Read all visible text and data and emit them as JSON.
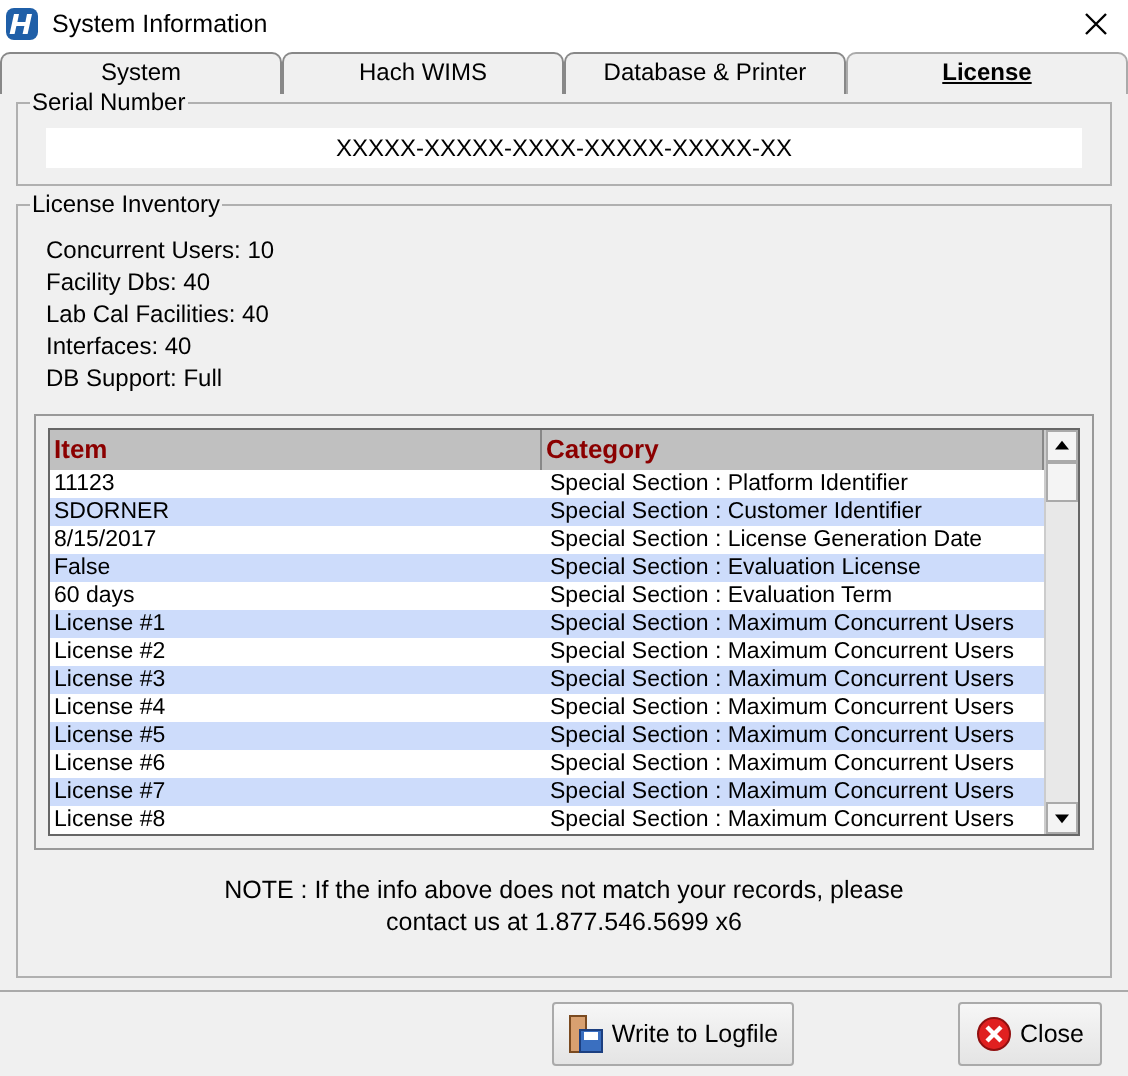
{
  "window": {
    "title": "System Information"
  },
  "tabs": [
    {
      "label": "System",
      "selected": false
    },
    {
      "label": "Hach WIMS",
      "selected": false
    },
    {
      "label": "Database & Printer",
      "selected": false
    },
    {
      "label": "License",
      "selected": true
    }
  ],
  "serial_number": {
    "label": "Serial Number",
    "value": "XXXXX-XXXXX-XXXX-XXXXX-XXXXX-XX"
  },
  "license_inventory": {
    "label": "License Inventory",
    "lines": [
      "Concurrent Users: 10",
      "Facility Dbs: 40",
      "Lab Cal Facilities: 40",
      "Interfaces: 40",
      "DB Support: Full"
    ],
    "table": {
      "columns": [
        "Item",
        "Category"
      ],
      "rows": [
        [
          "11123",
          "Special Section : Platform Identifier"
        ],
        [
          "SDORNER",
          "Special Section : Customer Identifier"
        ],
        [
          "8/15/2017",
          "Special Section : License Generation Date"
        ],
        [
          "False",
          "Special Section : Evaluation License"
        ],
        [
          "60 days",
          "Special Section : Evaluation Term"
        ],
        [
          "License #1",
          "Special Section : Maximum Concurrent Users"
        ],
        [
          "License #2",
          "Special Section : Maximum Concurrent Users"
        ],
        [
          "License #3",
          "Special Section : Maximum Concurrent Users"
        ],
        [
          "License #4",
          "Special Section : Maximum Concurrent Users"
        ],
        [
          "License #5",
          "Special Section : Maximum Concurrent Users"
        ],
        [
          "License #6",
          "Special Section : Maximum Concurrent Users"
        ],
        [
          "License #7",
          "Special Section : Maximum Concurrent Users"
        ],
        [
          "License #8",
          "Special Section : Maximum Concurrent Users"
        ]
      ]
    },
    "note": "NOTE : If the info above does not match your records, please contact us at 1.877.546.5699 x6"
  },
  "buttons": [
    {
      "label": "Write to Logfile",
      "kind": "log"
    },
    {
      "label": "Close",
      "kind": "close"
    }
  ]
}
